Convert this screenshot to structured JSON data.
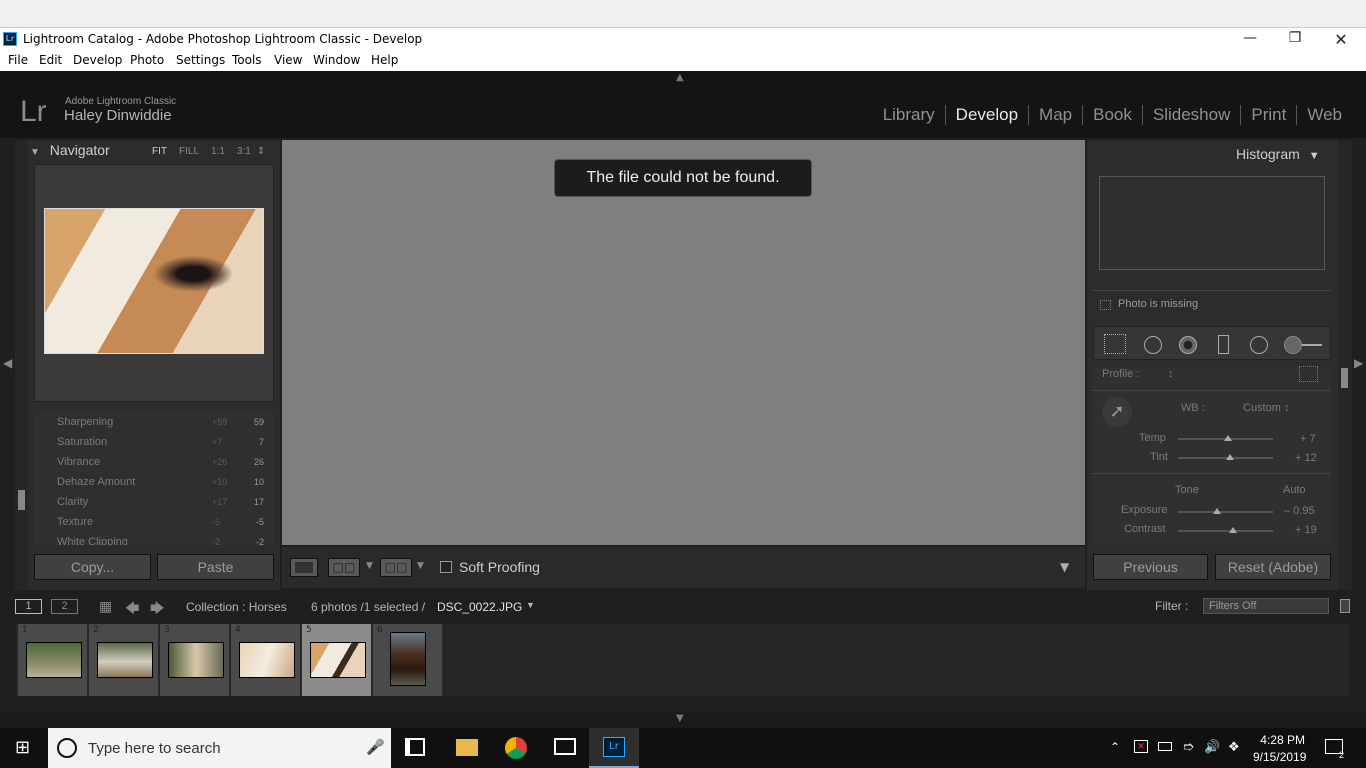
{
  "window": {
    "title": "Lightroom Catalog - Adobe Photoshop Lightroom Classic - Develop",
    "app_badge": "Lr",
    "controls": [
      "minimize-icon",
      "restore-icon",
      "close-icon"
    ]
  },
  "menu": [
    "File",
    "Edit",
    "Develop",
    "Photo",
    "Settings",
    "Tools",
    "View",
    "Window",
    "Help"
  ],
  "identity": {
    "logo": "Lr",
    "product": "Adobe Lightroom Classic",
    "user": "Haley Dinwiddie"
  },
  "modules": [
    "Library",
    "Develop",
    "Map",
    "Book",
    "Slideshow",
    "Print",
    "Web"
  ],
  "active_module": "Develop",
  "navigator": {
    "title": "Navigator",
    "zoom_options": [
      "FIT",
      "FILL",
      "1:1",
      "3:1"
    ]
  },
  "history": [
    {
      "name": "Sharpening",
      "delta": "+59",
      "value": "59"
    },
    {
      "name": "Saturation",
      "delta": "+7",
      "value": "7"
    },
    {
      "name": "Vibrance",
      "delta": "+26",
      "value": "26"
    },
    {
      "name": "Dehaze Amount",
      "delta": "+10",
      "value": "10"
    },
    {
      "name": "Clarity",
      "delta": "+17",
      "value": "17"
    },
    {
      "name": "Texture",
      "delta": "-5",
      "value": "-5"
    },
    {
      "name": "White Clipping",
      "delta": "-2",
      "value": "-2"
    }
  ],
  "left_buttons": {
    "copy": "Copy...",
    "paste": "Paste"
  },
  "center": {
    "message": "The file could not be found."
  },
  "toolbar": {
    "soft_proofing": "Soft Proofing"
  },
  "histogram": {
    "title": "Histogram",
    "missing": "Photo is missing"
  },
  "basic": {
    "profile_label": "Profile :",
    "profile_value": "↕",
    "wb_label": "WB :",
    "wb_value": "Custom ↕",
    "temp_label": "Temp",
    "temp_value": "+ 7",
    "tint_label": "Tint",
    "tint_value": "+ 12",
    "tone_label": "Tone",
    "auto_label": "Auto",
    "exposure_label": "Exposure",
    "exposure_value": "– 0.95",
    "contrast_label": "Contrast",
    "contrast_value": "+ 19"
  },
  "right_buttons": {
    "previous": "Previous",
    "reset": "Reset (Adobe)"
  },
  "filmstrip_bar": {
    "screen1": "1",
    "screen2": "2",
    "collection": "Collection : Horses",
    "count": "6 photos /1 selected /",
    "filename": "DSC_0022.JPG",
    "filter_label": "Filter :",
    "filter_value": "Filters Off"
  },
  "filmstrip": [
    "1",
    "2",
    "3",
    "4",
    "5",
    "6"
  ],
  "selected_thumb": "5",
  "taskbar": {
    "search_placeholder": "Type here to search",
    "time": "4:28 PM",
    "date": "9/15/2019",
    "notifications": "2"
  }
}
